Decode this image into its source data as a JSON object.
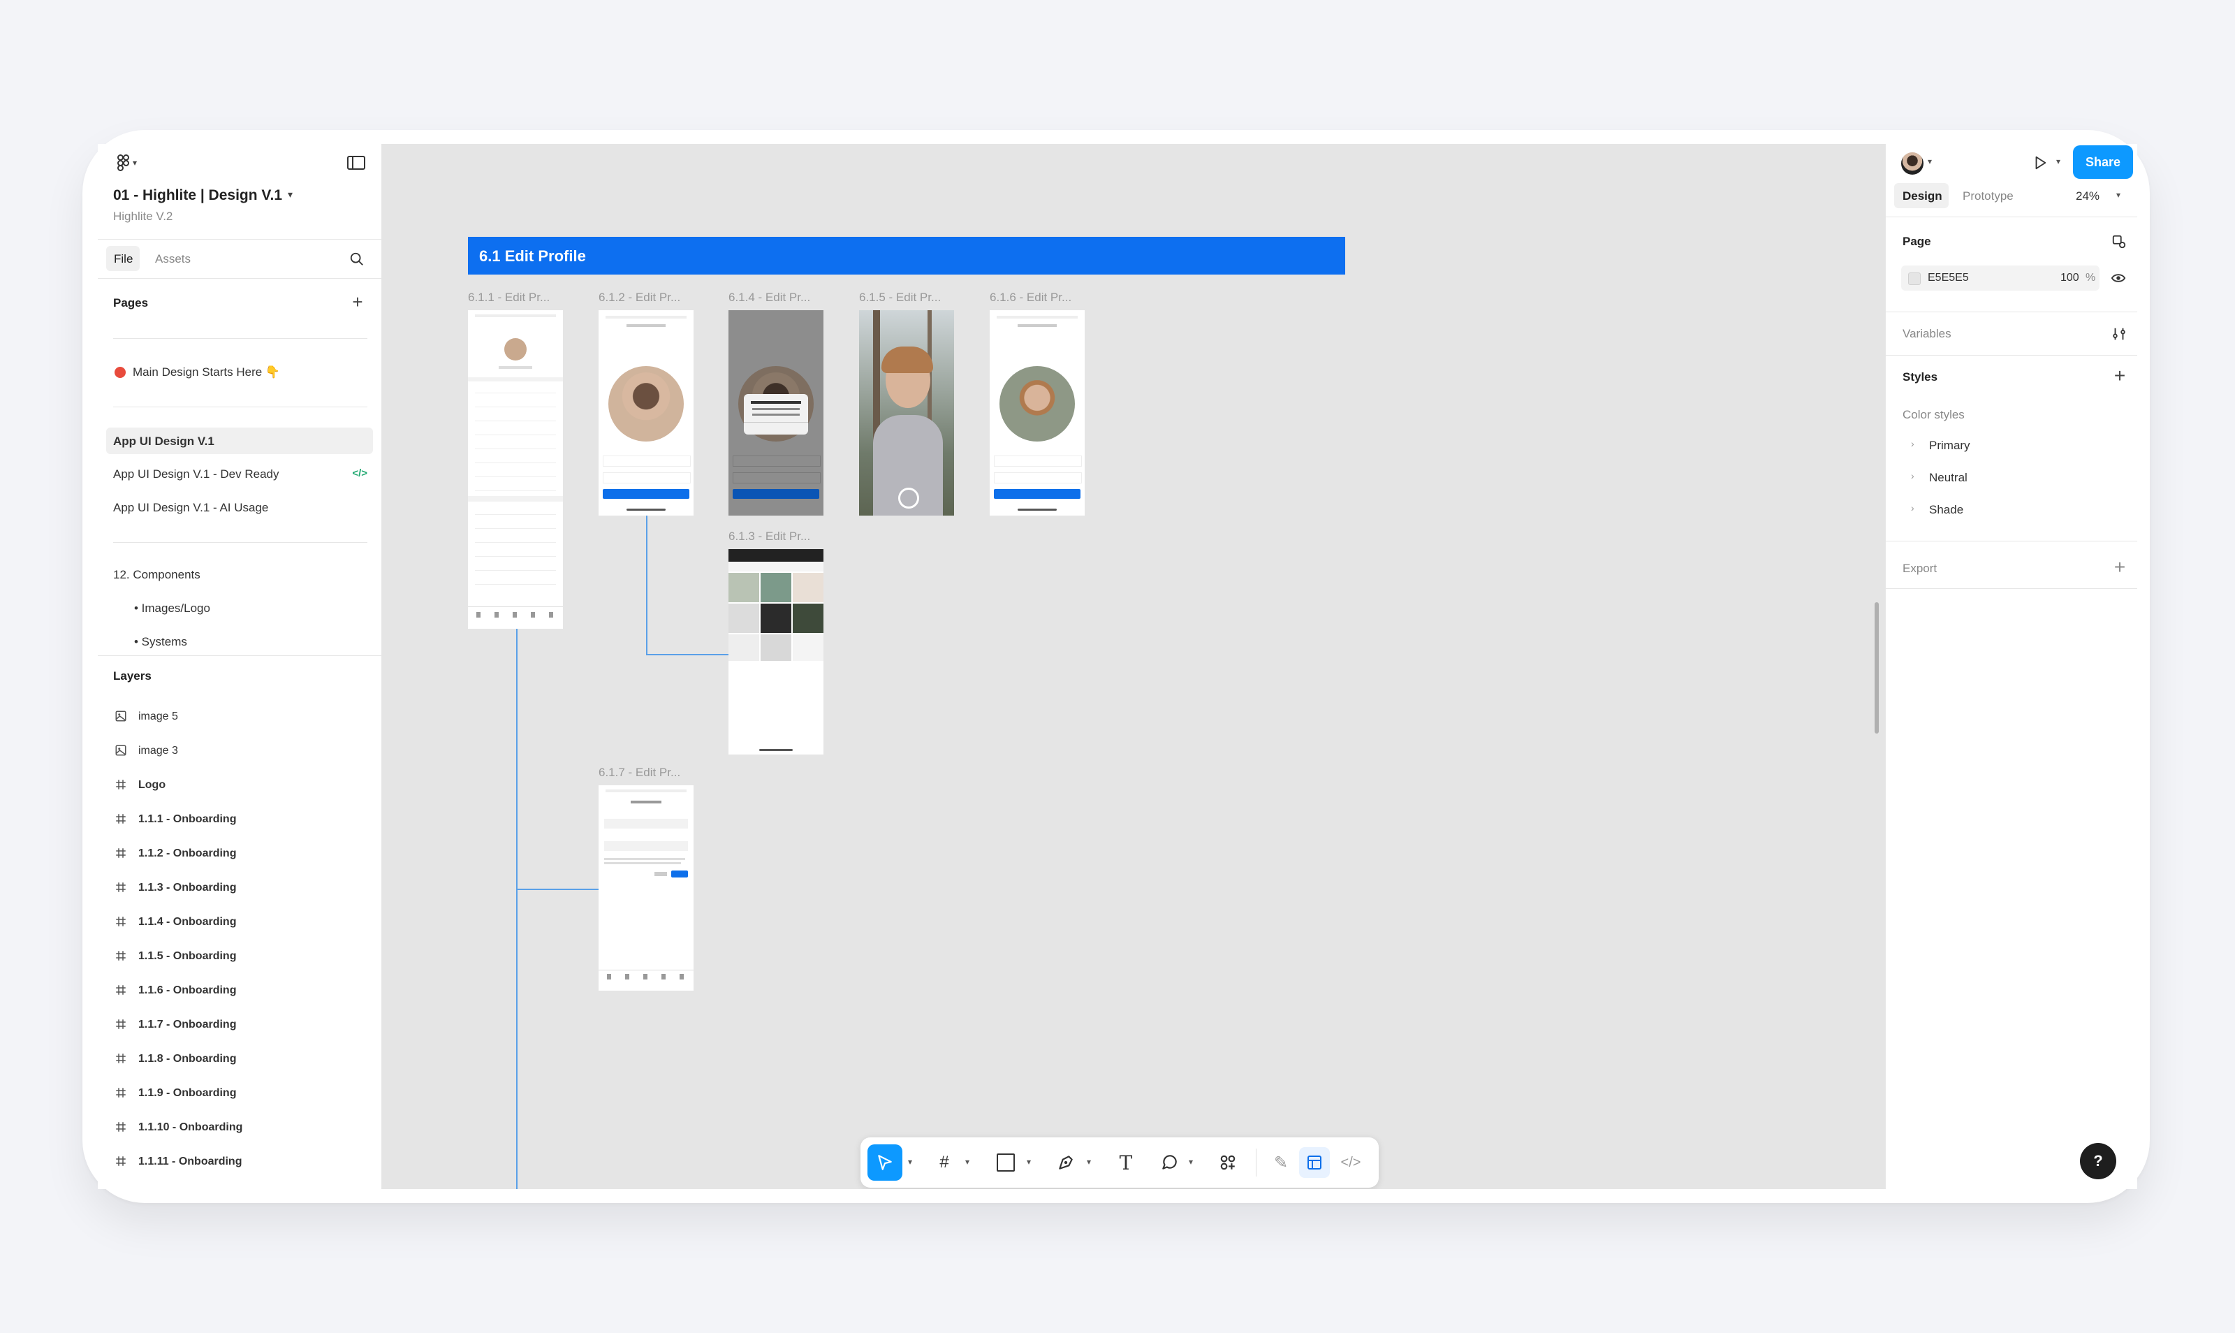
{
  "file": {
    "title": "01 - Highlite | Design V.1",
    "subtitle": "Highlite V.2"
  },
  "left_tabs": {
    "file": "File",
    "assets": "Assets"
  },
  "pages": {
    "heading": "Pages",
    "items": [
      {
        "label": "Main Design Starts Here 👇"
      },
      {
        "label": "App UI Design V.1"
      },
      {
        "label": "App UI Design V.1 - Dev Ready"
      },
      {
        "label": "App UI Design V.1 - AI Usage"
      },
      {
        "label": "12. Components"
      },
      {
        "label": "• Images/Logo"
      },
      {
        "label": "• Systems"
      }
    ]
  },
  "layers": {
    "heading": "Layers",
    "items": [
      {
        "label": "image 5",
        "icon": "image-icon"
      },
      {
        "label": "image 3",
        "icon": "image-icon"
      },
      {
        "label": "Logo",
        "icon": "frame-icon"
      },
      {
        "label": "1.1.1 - Onboarding",
        "icon": "frame-icon"
      },
      {
        "label": "1.1.2 - Onboarding",
        "icon": "frame-icon"
      },
      {
        "label": "1.1.3 - Onboarding",
        "icon": "frame-icon"
      },
      {
        "label": "1.1.4 - Onboarding",
        "icon": "frame-icon"
      },
      {
        "label": "1.1.5 - Onboarding",
        "icon": "frame-icon"
      },
      {
        "label": "1.1.6 - Onboarding",
        "icon": "frame-icon"
      },
      {
        "label": "1.1.7 - Onboarding",
        "icon": "frame-icon"
      },
      {
        "label": "1.1.8 - Onboarding",
        "icon": "frame-icon"
      },
      {
        "label": "1.1.9 - Onboarding",
        "icon": "frame-icon"
      },
      {
        "label": "1.1.10 - Onboarding",
        "icon": "frame-icon"
      },
      {
        "label": "1.1.11 - Onboarding",
        "icon": "frame-icon"
      }
    ]
  },
  "canvas": {
    "section_title": "6.1 Edit Profile",
    "frames": [
      {
        "label": "6.1.1 - Edit Pr..."
      },
      {
        "label": "6.1.2 - Edit Pr..."
      },
      {
        "label": "6.1.4 - Edit Pr..."
      },
      {
        "label": "6.1.5 - Edit Pr..."
      },
      {
        "label": "6.1.6 - Edit Pr..."
      },
      {
        "label": "6.1.3 - Edit Pr..."
      },
      {
        "label": "6.1.7 - Edit Pr..."
      }
    ]
  },
  "right_panel": {
    "share_label": "Share",
    "tab_design": "Design",
    "tab_prototype": "Prototype",
    "zoom": "24%",
    "page_heading": "Page",
    "page_color": "E5E5E5",
    "page_opacity": "100",
    "percent_sign": "%",
    "variables": "Variables",
    "styles_heading": "Styles",
    "color_styles": "Color styles",
    "styles": [
      "Primary",
      "Neutral",
      "Shade"
    ],
    "export": "Export",
    "help": "?"
  },
  "colors": {
    "accent": "#0d6fea",
    "canvas_bg": "#E5E5E5",
    "section_blue": "#0d6ff0",
    "status_dot": "#e84b3c"
  }
}
